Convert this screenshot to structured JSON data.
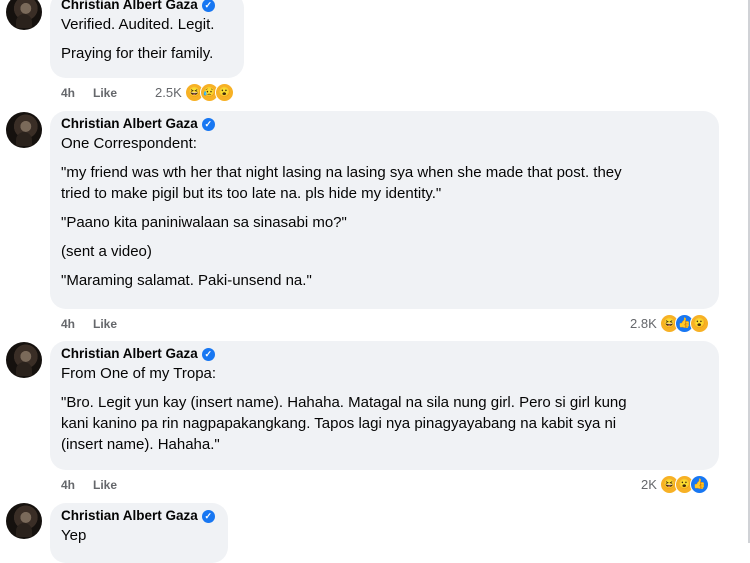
{
  "comments": [
    {
      "author": "Christian Albert Gaza",
      "paragraphs": [
        "Verified. Audited. Legit.",
        "Praying for their family."
      ],
      "time": "4h",
      "like_label": "Like",
      "reaction_count": "2.5K",
      "reactions": [
        "haha",
        "sad",
        "wow"
      ]
    },
    {
      "author": "Christian Albert Gaza",
      "paragraphs": [
        "One Correspondent:",
        "\"my friend was wth her that night lasing na lasing sya when she made that post. they",
        "tried to make pigil but its too late na. pls hide my identity.\"",
        "\"Paano kita paniniwalaan sa sinasabi mo?\"",
        "(sent a video)",
        "\"Maraming salamat. Paki-unsend na.\""
      ],
      "time": "4h",
      "like_label": "Like",
      "reaction_count": "2.8K",
      "reactions": [
        "haha",
        "like",
        "wow"
      ]
    },
    {
      "author": "Christian Albert Gaza",
      "paragraphs": [
        "From One of my Tropa:",
        "\"Bro. Legit yun kay (insert name). Hahaha. Matagal na sila nung girl. Pero si girl kung",
        "kani kanino pa rin nagpapakangkang. Tapos lagi nya pinagyayabang na kabit sya ni",
        "(insert name). Hahaha.\""
      ],
      "time": "4h",
      "like_label": "Like",
      "reaction_count": "2K",
      "reactions": [
        "haha",
        "wow",
        "like"
      ]
    },
    {
      "author": "Christian Albert Gaza",
      "paragraphs": [
        "Yep"
      ]
    }
  ]
}
